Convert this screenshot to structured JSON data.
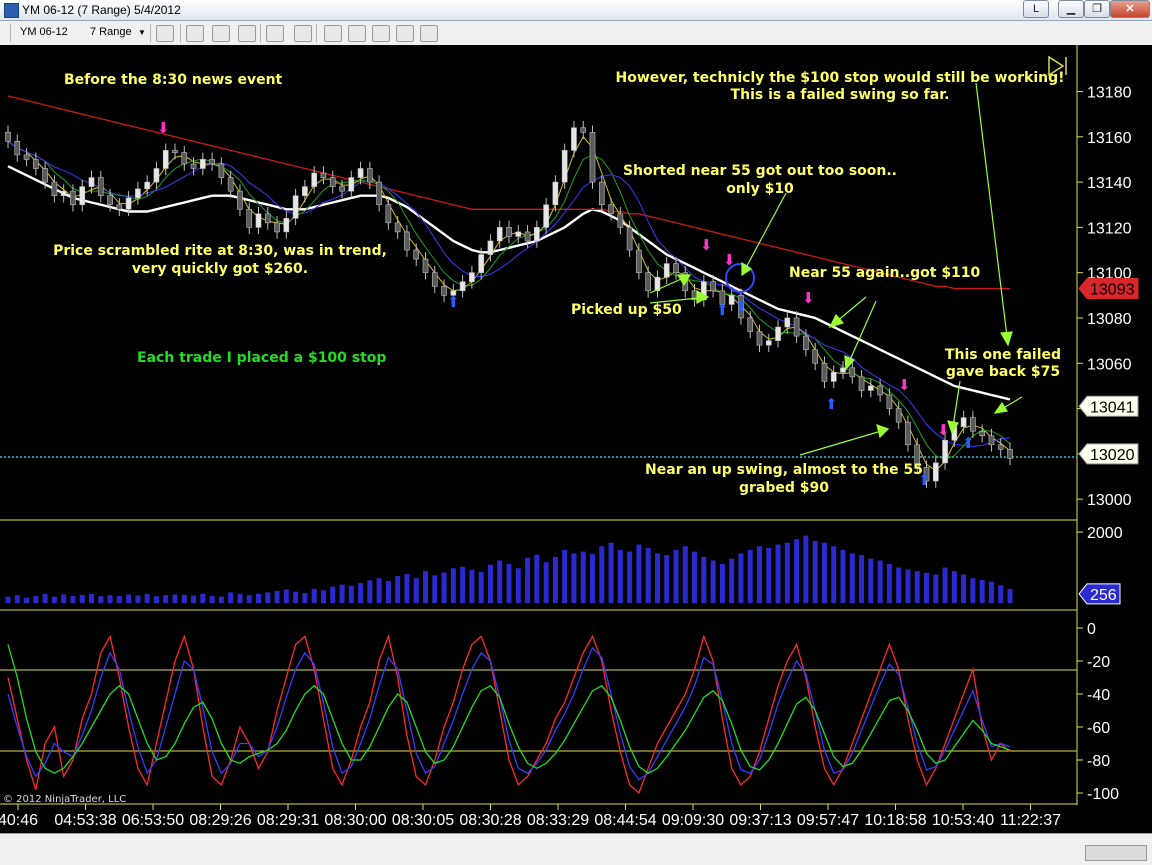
{
  "window": {
    "title": "YM 06-12 (7 Range)  5/4/2012",
    "min_label": "L"
  },
  "toolbar": {
    "instrument": "YM 06-12",
    "interval": "7 Range"
  },
  "chart_data": [
    {
      "type": "candlestick",
      "panel": "price",
      "x_tick_labels": [
        "40:46",
        "04:53:38",
        "06:53:50",
        "08:29:26",
        "08:29:31",
        "08:30:00",
        "08:30:05",
        "08:30:28",
        "08:33:29",
        "08:44:54",
        "09:09:30",
        "09:37:13",
        "09:57:47",
        "10:18:58",
        "10:53:40",
        "11:22:37"
      ],
      "y_tick_labels": [
        "13180",
        "13160",
        "13140",
        "13120",
        "13100",
        "13080",
        "13060",
        "13040",
        "13020",
        "13000"
      ],
      "ylim": [
        12993,
        13197
      ],
      "candle_closes": [
        13158,
        13152,
        13150,
        13146,
        13140,
        13134,
        13136,
        13130,
        13138,
        13142,
        13134,
        13130,
        13128,
        13133,
        13137,
        13140,
        13146,
        13154,
        13153,
        13148,
        13146,
        13150,
        13148,
        13142,
        13136,
        13128,
        13120,
        13126,
        13122,
        13118,
        13124,
        13134,
        13138,
        13144,
        13142,
        13138,
        13136,
        13142,
        13146,
        13140,
        13130,
        13122,
        13118,
        13110,
        13106,
        13100,
        13094,
        13090,
        13092,
        13096,
        13100,
        13108,
        13114,
        13120,
        13116,
        13118,
        13114,
        13120,
        13130,
        13140,
        13154,
        13164,
        13162,
        13140,
        13130,
        13126,
        13120,
        13110,
        13100,
        13092,
        13098,
        13104,
        13100,
        13092,
        13088,
        13096,
        13092,
        13086,
        13090,
        13080,
        13074,
        13068,
        13070,
        13076,
        13080,
        13072,
        13066,
        13060,
        13052,
        13056,
        13058,
        13054,
        13048,
        13050,
        13046,
        13040,
        13034,
        13024,
        13014,
        13008,
        13016,
        13026,
        13032,
        13036,
        13030,
        13028,
        13024,
        13022,
        13018
      ],
      "series": [
        {
          "name": "EMA 55",
          "color": "#ffffff",
          "values": [
            13147,
            13145,
            13143,
            13141,
            13139,
            13137,
            13135,
            13133,
            13132,
            13131,
            13130,
            13129,
            13128,
            13127,
            13127,
            13127,
            13128,
            13129,
            13130,
            13131,
            13132,
            13133,
            13134,
            13134,
            13134,
            13133,
            13132,
            13131,
            13130,
            13129,
            13128,
            13128,
            13128,
            13129,
            13130,
            13131,
            13132,
            13133,
            13134,
            13134,
            13134,
            13133,
            13131,
            13129,
            13126,
            13123,
            13120,
            13117,
            13114,
            13112,
            13110,
            13109,
            13109,
            13110,
            13111,
            13112,
            13113,
            13114,
            13116,
            13118,
            13120,
            13123,
            13126,
            13128,
            13127,
            13125,
            13123,
            13120,
            13117,
            13114,
            13111,
            13108,
            13106,
            13104,
            13102,
            13100,
            13098,
            13096,
            13094,
            13092,
            13090,
            13088,
            13086,
            13084,
            13083,
            13082,
            13081,
            13080,
            13078,
            13076,
            13074,
            13072,
            13070,
            13068,
            13066,
            13064,
            13062,
            13060,
            13058,
            13056,
            13054,
            13052,
            13050,
            13049,
            13048,
            13047,
            13046,
            13045,
            13044
          ]
        },
        {
          "name": "Red MA",
          "color": "#cc1a1a",
          "values": [
            13178,
            13177,
            13176,
            13175,
            13174,
            13173,
            13172,
            13171,
            13170,
            13169,
            13168,
            13167,
            13166,
            13165,
            13164,
            13163,
            13162,
            13161,
            13160,
            13159,
            13158,
            13157,
            13156,
            13155,
            13154,
            13153,
            13152,
            13151,
            13150,
            13149,
            13148,
            13147,
            13146,
            13145,
            13144,
            13143,
            13142,
            13141,
            13140,
            13139,
            13138,
            13137,
            13136,
            13135,
            13134,
            13133,
            13132,
            13131,
            13130,
            13129,
            13128,
            13128,
            13128,
            13128,
            13128,
            13128,
            13128,
            13128,
            13128,
            13128,
            13128,
            13128,
            13128,
            13128,
            13128,
            13127,
            13127,
            13126,
            13126,
            13125,
            13124,
            13123,
            13122,
            13121,
            13120,
            13119,
            13118,
            13117,
            13116,
            13115,
            13114,
            13113,
            13112,
            13111,
            13110,
            13109,
            13108,
            13107,
            13106,
            13105,
            13104,
            13103,
            13102,
            13101,
            13100,
            13099,
            13098,
            13097,
            13096,
            13095,
            13094,
            13094,
            13093,
            13093,
            13093,
            13093,
            13093,
            13093,
            13093
          ]
        }
      ],
      "price_markers": [
        {
          "value": 13093,
          "label": "13093",
          "color": "#d8262a"
        },
        {
          "value": 13041,
          "label": "13041",
          "color": "#fffff0"
        },
        {
          "value": 13020,
          "label": "13020",
          "color": "#fffff0"
        }
      ],
      "annotations": [
        "Before the 8:30 news event",
        "Price scrambled rite at 8:30, was in trend, very quickly got $260.",
        "Each trade I placed a $100 stop",
        "Shorted near 55 got out too soon.. only $10",
        "Picked up $50",
        "Near 55 again..got $110",
        "However, technicly the $100 stop would still be working! This is a failed swing so far.",
        "This one failed gave back $75",
        "Near an up swing, almost to the 55 grabed $90"
      ]
    },
    {
      "type": "bar",
      "panel": "volume",
      "y_tick_labels": [
        "2000"
      ],
      "ylim": [
        0,
        2200
      ],
      "current_label": "256",
      "values": [
        180,
        220,
        150,
        200,
        260,
        180,
        240,
        200,
        230,
        260,
        190,
        220,
        200,
        240,
        210,
        250,
        190,
        220,
        240,
        230,
        210,
        260,
        200,
        180,
        300,
        250,
        220,
        260,
        300,
        340,
        380,
        320,
        280,
        400,
        360,
        460,
        520,
        480,
        560,
        640,
        700,
        620,
        760,
        820,
        700,
        900,
        780,
        860,
        980,
        1020,
        940,
        880,
        1080,
        1200,
        1100,
        980,
        1280,
        1360,
        1150,
        1300,
        1500,
        1400,
        1450,
        1380,
        1600,
        1700,
        1500,
        1450,
        1650,
        1550,
        1400,
        1350,
        1500,
        1600,
        1450,
        1300,
        1200,
        1100,
        1250,
        1400,
        1500,
        1600,
        1550,
        1650,
        1700,
        1800,
        1900,
        1750,
        1700,
        1600,
        1500,
        1400,
        1350,
        1250,
        1200,
        1100,
        1000,
        950,
        900,
        850,
        800,
        1000,
        900,
        800,
        700,
        650,
        600,
        500,
        400
      ]
    },
    {
      "type": "line",
      "panel": "oscillator",
      "y_tick_labels": [
        "0",
        "-20",
        "-40",
        "-60",
        "-80",
        "-100"
      ],
      "ylim": [
        -100,
        0
      ],
      "series": [
        {
          "name": "red",
          "color": "#ff2a2a",
          "values": [
            -30,
            -55,
            -80,
            -98,
            -70,
            -60,
            -90,
            -80,
            -55,
            -40,
            -15,
            -5,
            -30,
            -60,
            -85,
            -95,
            -70,
            -45,
            -20,
            -5,
            -25,
            -60,
            -90,
            -95,
            -80,
            -60,
            -70,
            -85,
            -75,
            -50,
            -30,
            -10,
            -5,
            -25,
            -55,
            -85,
            -95,
            -80,
            -60,
            -45,
            -20,
            -5,
            -30,
            -65,
            -90,
            -95,
            -80,
            -60,
            -45,
            -25,
            -10,
            -5,
            -20,
            -50,
            -80,
            -95,
            -90,
            -80,
            -70,
            -55,
            -45,
            -30,
            -15,
            -5,
            -20,
            -50,
            -75,
            -95,
            -100,
            -85,
            -70,
            -60,
            -50,
            -40,
            -25,
            -5,
            -20,
            -55,
            -85,
            -95,
            -90,
            -75,
            -55,
            -35,
            -20,
            -10,
            -30,
            -60,
            -85,
            -95,
            -85,
            -70,
            -55,
            -40,
            -25,
            -10,
            -25,
            -55,
            -80,
            -95,
            -85,
            -70,
            -55,
            -40,
            -25,
            -60,
            -80,
            -70,
            -75
          ]
        },
        {
          "name": "blue",
          "color": "#3b3bff",
          "values": [
            -40,
            -60,
            -78,
            -90,
            -82,
            -70,
            -75,
            -78,
            -65,
            -50,
            -30,
            -15,
            -25,
            -50,
            -72,
            -88,
            -80,
            -60,
            -40,
            -20,
            -25,
            -48,
            -75,
            -88,
            -82,
            -70,
            -70,
            -78,
            -74,
            -60,
            -42,
            -25,
            -15,
            -22,
            -45,
            -72,
            -88,
            -84,
            -70,
            -55,
            -35,
            -18,
            -25,
            -50,
            -76,
            -88,
            -84,
            -70,
            -56,
            -40,
            -25,
            -15,
            -20,
            -42,
            -68,
            -85,
            -88,
            -82,
            -74,
            -62,
            -52,
            -40,
            -25,
            -12,
            -18,
            -40,
            -64,
            -84,
            -92,
            -88,
            -78,
            -68,
            -58,
            -48,
            -35,
            -18,
            -22,
            -44,
            -70,
            -86,
            -88,
            -80,
            -64,
            -46,
            -32,
            -20,
            -28,
            -50,
            -74,
            -88,
            -86,
            -76,
            -62,
            -48,
            -34,
            -22,
            -28,
            -48,
            -70,
            -86,
            -84,
            -74,
            -62,
            -50,
            -38,
            -56,
            -72,
            -70,
            -72
          ]
        },
        {
          "name": "green",
          "color": "#22dd22",
          "values": [
            -10,
            -30,
            -55,
            -75,
            -85,
            -88,
            -85,
            -78,
            -70,
            -60,
            -50,
            -40,
            -35,
            -40,
            -55,
            -70,
            -80,
            -78,
            -70,
            -58,
            -48,
            -45,
            -55,
            -70,
            -80,
            -82,
            -78,
            -76,
            -74,
            -70,
            -62,
            -50,
            -40,
            -35,
            -40,
            -55,
            -70,
            -80,
            -80,
            -72,
            -60,
            -48,
            -40,
            -45,
            -60,
            -75,
            -82,
            -80,
            -72,
            -60,
            -48,
            -38,
            -35,
            -42,
            -58,
            -72,
            -82,
            -85,
            -82,
            -76,
            -68,
            -58,
            -48,
            -38,
            -35,
            -42,
            -56,
            -72,
            -84,
            -88,
            -85,
            -78,
            -70,
            -62,
            -52,
            -42,
            -38,
            -44,
            -58,
            -74,
            -84,
            -86,
            -80,
            -70,
            -58,
            -46,
            -42,
            -50,
            -64,
            -78,
            -84,
            -82,
            -74,
            -64,
            -54,
            -44,
            -42,
            -50,
            -62,
            -76,
            -82,
            -80,
            -72,
            -64,
            -56,
            -62,
            -70,
            -72,
            -74
          ]
        }
      ]
    }
  ],
  "copyright": "© 2012 NinjaTrader, LLC",
  "colors": {
    "annotation_yellow": "#ffff66",
    "annotation_green": "#22dd22",
    "arrow_green": "#99ff33",
    "up_arrow_blue": "#2b5cff",
    "down_arrow_magenta": "#ff33cc",
    "dotted_line": "#35c2d6"
  }
}
